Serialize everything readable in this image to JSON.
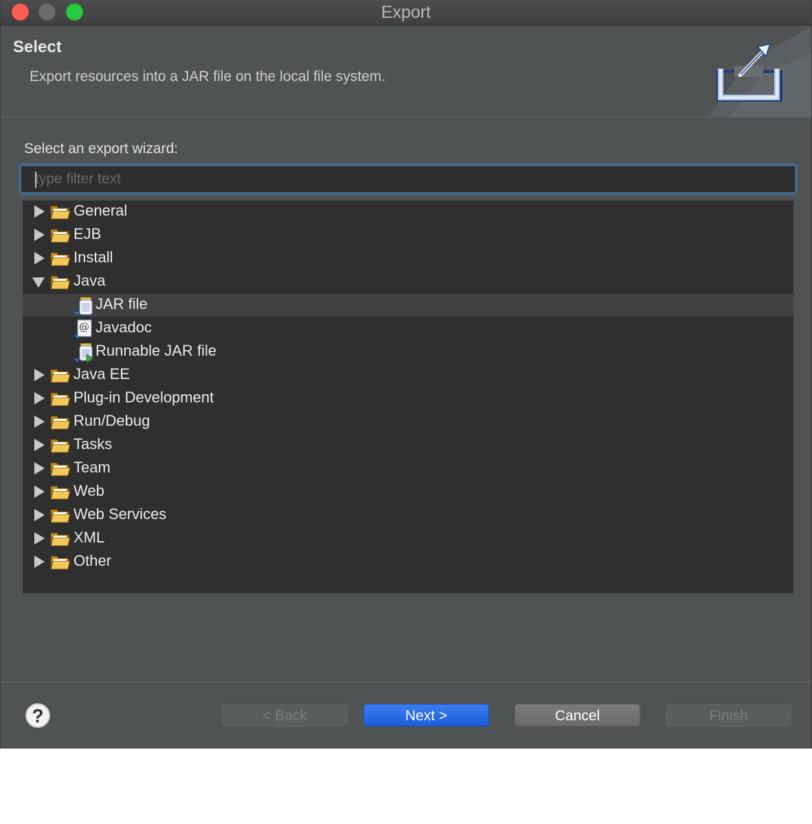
{
  "window": {
    "title": "Export"
  },
  "header": {
    "title": "Select",
    "description": "Export resources into a JAR file on the local file system."
  },
  "prompt": "Select an export wizard:",
  "filter": {
    "value": "",
    "placeholder": "type filter text"
  },
  "tree": {
    "rows": [
      {
        "label": "General",
        "level": 1,
        "expanded": false
      },
      {
        "label": "EJB",
        "level": 1,
        "expanded": false
      },
      {
        "label": "Install",
        "level": 1,
        "expanded": false
      },
      {
        "label": "Java",
        "level": 1,
        "expanded": true
      },
      {
        "label": "JAR file",
        "level": 2,
        "icon": "jar-icon",
        "selected": true
      },
      {
        "label": "Javadoc",
        "level": 2,
        "icon": "javadoc-icon"
      },
      {
        "label": "Runnable JAR file",
        "level": 2,
        "icon": "runnable-jar-icon"
      },
      {
        "label": "Java EE",
        "level": 1,
        "expanded": false
      },
      {
        "label": "Plug-in Development",
        "level": 1,
        "expanded": false
      },
      {
        "label": "Run/Debug",
        "level": 1,
        "expanded": false
      },
      {
        "label": "Tasks",
        "level": 1,
        "expanded": false
      },
      {
        "label": "Team",
        "level": 1,
        "expanded": false
      },
      {
        "label": "Web",
        "level": 1,
        "expanded": false
      },
      {
        "label": "Web Services",
        "level": 1,
        "expanded": false
      },
      {
        "label": "XML",
        "level": 1,
        "expanded": false
      },
      {
        "label": "Other",
        "level": 1,
        "expanded": false
      }
    ]
  },
  "buttons": {
    "help": "?",
    "back": "< Back",
    "next": "Next >",
    "cancel": "Cancel",
    "finish": "Finish"
  },
  "colors": {
    "accent": "#1a5ed8",
    "focus_ring": "#43698f",
    "folder": "#e8b53e"
  }
}
